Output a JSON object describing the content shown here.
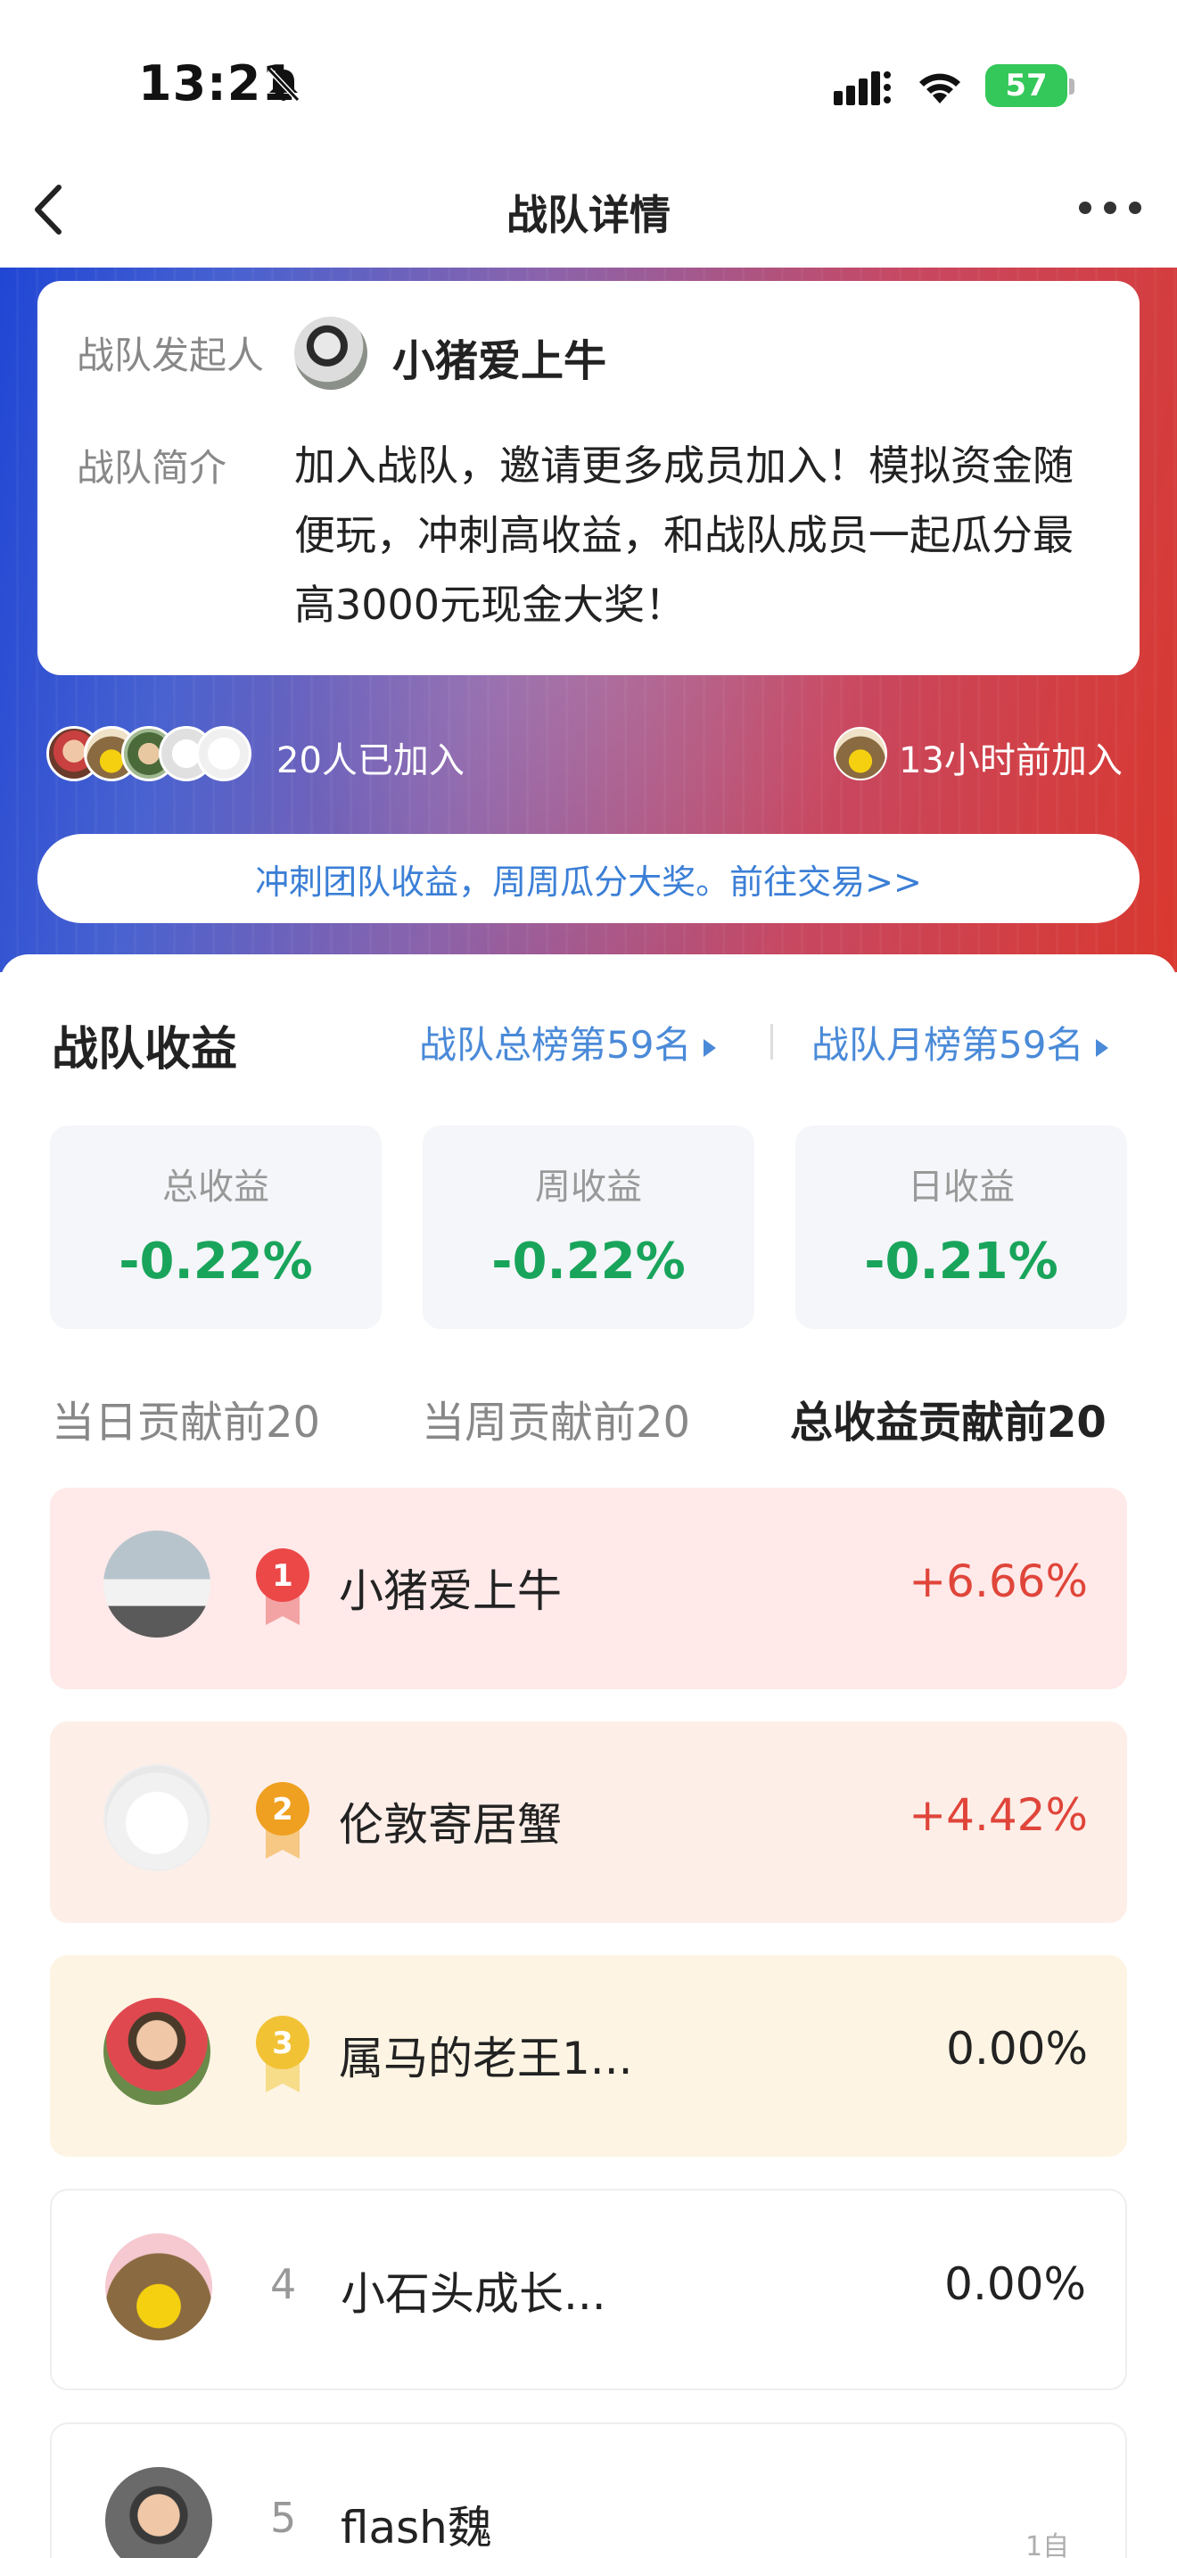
{
  "status_bar": {
    "time": "13:21",
    "battery": "57"
  },
  "nav": {
    "title": "战队详情"
  },
  "team_info": {
    "founder_label": "战队发起人",
    "founder_name": "小猪爱上牛",
    "intro_label": "战队简介",
    "intro_text": "加入战队，邀请更多成员加入！模拟资金随便玩，冲刺高收益，和战队成员一起瓜分最高3000元现金大奖！"
  },
  "members": {
    "joined_count": "20人已加入",
    "recent_join": "13小时前加入"
  },
  "cta_banner": "冲刺团队收益，周周瓜分大奖。前往交易>>",
  "earnings": {
    "title": "战队收益",
    "total_rank_link": "战队总榜第59名",
    "month_rank_link": "战队月榜第59名",
    "stats": [
      {
        "label": "总收益",
        "value": "-0.22%"
      },
      {
        "label": "周收益",
        "value": "-0.22%"
      },
      {
        "label": "日收益",
        "value": "-0.21%"
      }
    ],
    "accent_color": "#19a45b"
  },
  "tabs": [
    {
      "label": "当日贡献前20",
      "active": false
    },
    {
      "label": "当周贡献前20",
      "active": false
    },
    {
      "label": "总收益贡献前20",
      "active": true
    }
  ],
  "leaderboard": [
    {
      "rank": "1",
      "name": "小猪爱上牛",
      "value": "+6.66%",
      "bg": "#ffe9e9",
      "medal_color": "#ec4848"
    },
    {
      "rank": "2",
      "name": "伦敦寄居蟹",
      "value": "+4.42%",
      "bg": "#fdeee8",
      "medal_color": "#f0a020"
    },
    {
      "rank": "3",
      "name": "属马的老王1...",
      "value": "0.00%",
      "bg": "#fdf4e3",
      "medal_color": "#f2c235"
    },
    {
      "rank": "4",
      "name": "小石头成长...",
      "value": "0.00%",
      "bg": "#ffffff"
    },
    {
      "rank": "5",
      "name": "flash魏",
      "value": "",
      "bg": "#ffffff"
    }
  ],
  "watermark": "1自"
}
